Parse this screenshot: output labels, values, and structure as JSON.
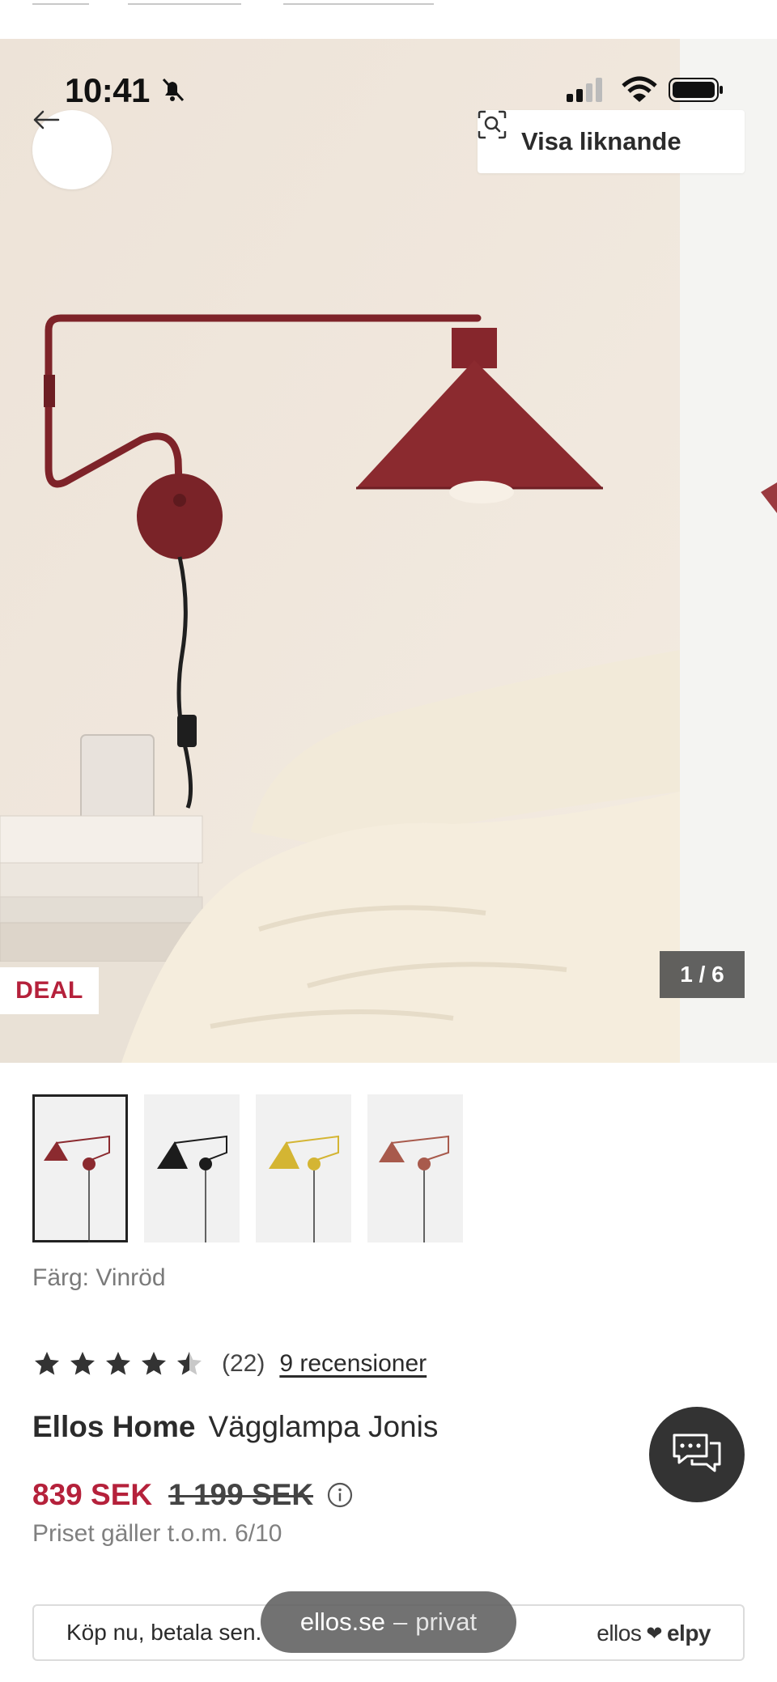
{
  "status_bar": {
    "time": "10:41"
  },
  "hero": {
    "similar_label": "Visa liknande",
    "deal_badge": "DEAL",
    "counter": "1 / 6"
  },
  "thumbnails": [
    {
      "color": "#8b2a2f",
      "selected": true
    },
    {
      "color": "#1c1c1c",
      "selected": false
    },
    {
      "color": "#d4b533",
      "selected": false
    },
    {
      "color": "#a85a4c",
      "selected": false
    }
  ],
  "product": {
    "color_label": "Färg: Vinröd",
    "rating_value": 4.5,
    "rating_count": "(22)",
    "reviews_link": "9 recensioner",
    "brand": "Ellos Home",
    "name": "Vägglampa Jonis",
    "price_now": "839 SEK",
    "price_was": "1 199 SEK",
    "price_note": "Priset gäller t.o.m. 6/10"
  },
  "payment": {
    "text": "Köp nu, betala sen.",
    "logo_left": "ellos",
    "logo_right": "elpy"
  },
  "browser": {
    "domain": "ellos.se",
    "separator": "–",
    "mode": "privat"
  },
  "colors": {
    "accent_red": "#b5213b",
    "lamp": "#8b2a2f",
    "wall": "#efe6dc"
  }
}
